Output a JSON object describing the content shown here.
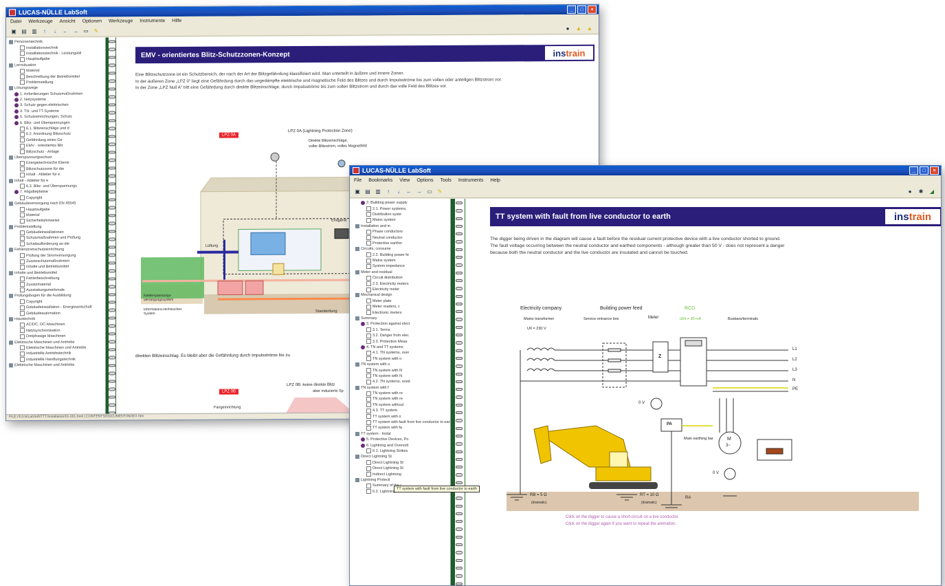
{
  "back_window": {
    "title": "LUCAS-NÜLLE LabSoft",
    "menu": [
      "Datei",
      "Werkzeuge",
      "Ansicht",
      "Optionen",
      "Werkzeuge",
      "Instrumente",
      "Hilfe"
    ],
    "banner_title": "EMV - orientiertes Blitz-Schutzzonen-Konzept",
    "logo": {
      "a": "ins",
      "b": "train"
    },
    "paragraphs": [
      "Eine Blitzschutzzone ist ein Schutzbereich, der nach der Art der Blitzgefährdung klassifiziert wird. Man unterteilt in äußere und innere Zonen.",
      "In der äußeren Zone „LPZ 0\" liegt eine Gefährdung durch das ungedämpfte elektrische und magnetische Feld des Blitzes und durch Impulsströme bis zum vollen oder anteiligen Blitzstrom vor.",
      "In der Zone „LPZ Null A\" tritt eine Gefährdung durch direkte Blitzeinschläge, durch Impulsströme bis zum vollen Blitzstrom und durch das volle Feld des Blitzes vor."
    ],
    "diagram": {
      "tag1": "LPZ 0A",
      "lpz_label": "LPZ 0A (Lightning Protection Zone)",
      "lpz_desc1": "Direkte Blitzeinschläge,",
      "lpz_desc2": "voller Blitzstrom, volles Magnetfeld",
      "luftung": "Lüftung",
      "endgerat": "Endgerät",
      "box1": "Niederspannungs-versorgungssystem",
      "box2": "Informations-technisches System",
      "stand": "Standerdung",
      "after_text": "direkten Blitzeinschlag. Es bleibt aber die Gefährdung durch Impulsströme bis zu",
      "tag2": "LPZ 0B",
      "lpz2": "LPZ 0B: keine direkte Blitz",
      "lpz2b": "aber induzierte Sp",
      "fang": "Fangeinrichtung"
    },
    "tree": [
      "Personentechnik",
      "Installationstechnik",
      "Installationstechnik - Leistungsbil",
      "Hauptaufgabe",
      "Lernsituation",
      "Material",
      "Beschreibung der Betriebsmittel",
      "Problemstellung",
      "Lösungswege",
      "1. Anforderungen Schutzmaßnahmen",
      "2. Netzsysteme",
      "3. Schutz gegen elektrischen",
      "4. TN- und TT-Systeme",
      "5. Schutzeinrichtungen, Schutz",
      "6. Blitz- und Überspannungen",
      "6.1. Blitzeinschläge und d",
      "6.2. Anordnung Blitzschutz",
      "Gefährdung eines Ge",
      "EMV - orientiertes Blit",
      "Blitzschutz - Anlage",
      "Überspannungsschutz",
      "Energietechnische Ebene",
      "Blitzschutzzone für die",
      "Inhalt - Ableiter für e",
      "Inhalt - Ableiter für e",
      "6.3. Blitz- und Überspannungs",
      "7. Abgabeplatine",
      "Copyright",
      "Gebäudeversorgung nach EN 45545",
      "Hauptaufgabe",
      "Material",
      "Sicherheitshinweise",
      "Problemstellung",
      "Gebäudeinstallationen",
      "Schutzmaßnahmen und Prüfung",
      "Schaltaufforderung an die",
      "Fehlerstromschutzeinrichtung",
      "Prüfung der Stromversorgung",
      "Zusatzschutzmaßnahmen",
      "Inhalte und Betriebsmittel",
      "Inhalte und Betriebsmittel",
      "Fehlerbeschreibung",
      "Zusatzmaterial",
      "Ausstattungsmerkmale",
      "Prüfungsbogen für die Ausbildung",
      "Copyright",
      "Gebäudeinstallation - Energiewirtschaft",
      "Gebäudeautomation",
      "Haustechnik",
      "AC/DC, DC-Maschinen",
      "Netzsynchronisation",
      "Dreiphasige Maschinen",
      "Elektrische Maschinen und Antriebe",
      "Elektrische Maschinen und Antriebe",
      "Industrielle Antriebstechnik",
      "Industrielle Handlungstechnik",
      "Elektrische Maschinen und Antriebe"
    ],
    "status": "FILE://C/LN/LabSoft/TTT/installation/01-001.html | CONTENTS/DOCUMENT/INDEX.htm"
  },
  "front_window": {
    "title": "LUCAS-NÜLLE LabSoft",
    "menu": [
      "File",
      "Bookmarks",
      "View",
      "Options",
      "Tools",
      "Instruments",
      "Help"
    ],
    "banner_title": "TT system with fault from live conductor to earth",
    "logo": {
      "a": "ins",
      "b": "train"
    },
    "paragraphs": [
      "The digger being driven in the diagram will cause a fault before the residual current protective device with a live conductor shorted to ground.",
      "The fault voltage occurring between the neutral conductor and earthed components - although greater than 50 V - does not represent a danger",
      "because both the neutral conductor and the live conductor are insulated and cannot be touched."
    ],
    "diagram": {
      "electricity_company": "Electricity company",
      "mains_transformer": "Mains transformer",
      "u0": "U0 = 230 V",
      "building_power_feed": "Building power feed",
      "service_entrance_box": "Service entrance box",
      "meter": "Meter",
      "rcd": "RCD",
      "rcd_current": "IΔN = 30 mA",
      "busbars": "Busbars/terminals",
      "lines": [
        "L1",
        "L2",
        "L3",
        "N",
        "PE"
      ],
      "zero_v_left": "0 V",
      "zero_v_right": "0 V",
      "pa": "PA",
      "main_earthing_bar": "Main earthing bar",
      "motor": "M",
      "motor_sub": "3~",
      "z": "Z",
      "rb": "RB = 5 Ω",
      "rb_sub": "(dramatic)",
      "rt": "RT = 10 Ω",
      "rt_sub": "(dramatic)",
      "ra": "RA",
      "instruction1": "Click on the digger to cause a short-circuit on a live conductor.",
      "instruction2": "Click on the digger again if you want to repeat the animation."
    },
    "tooltip": "TT system with fault from live conductor to earth",
    "tree": [
      "2. Building power supply",
      "2.1. Power systems,",
      "Distribution syste",
      "Mains system",
      "Installation and m",
      "Phase conductors",
      "Neutral conductor",
      "Protective earthin",
      "Circuits, consume",
      "2.2. Building power fe",
      "Mains system",
      "System impedance",
      "Meter and residual",
      "Circuit distribution",
      "2.3. Electricity meters",
      "Electricity meter",
      "Mechanical design",
      "Meter plate",
      "Meter readers, c",
      "Electronic meters",
      "Summary",
      "3. Protection against elect",
      "3.1. Terms",
      "3.2. Danger from elec",
      "3.3. Protection Meas",
      "4. TN and TT systems",
      "4.1. TN systems, over",
      "TN system with o",
      "TN system with o",
      "TN system with N",
      "TN system with N",
      "4.2. TN systems, resid",
      "TN system with f",
      "TN system with re",
      "TN system with re",
      "TN system without",
      "4.3. TT system",
      "TT system with o",
      "TT system with fault from live conductor to earth",
      "TT system with fa",
      "TT system - Instal",
      "5. Protective Devices, Po",
      "6. Lightning and Overvolt",
      "6.1. Lightning Strikes",
      "Direct Lightning St",
      "Direct Lightning St",
      "Direct Lightning St",
      "Indirect Lightning",
      "Lightning Protecti",
      "Summary of the r",
      "6.2. Lightning Protecti"
    ]
  }
}
